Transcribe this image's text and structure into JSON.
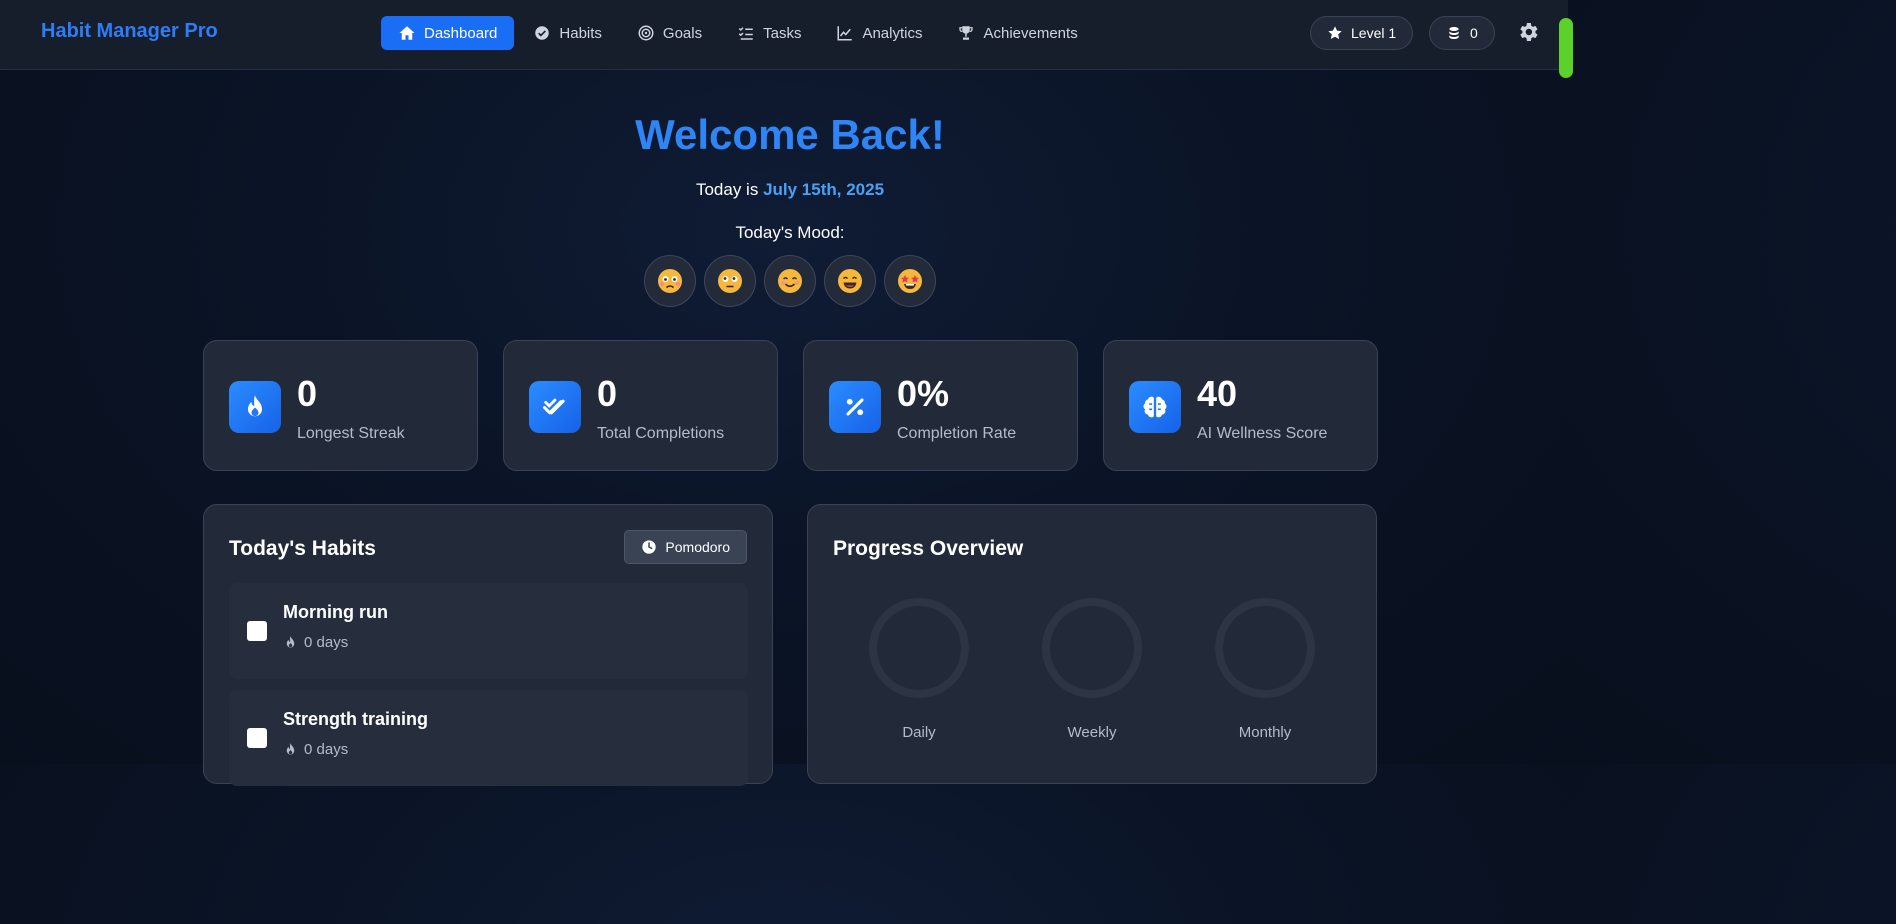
{
  "app": {
    "brand": "Habit Manager Pro"
  },
  "nav": {
    "items": [
      {
        "label": "Dashboard",
        "icon": "home-icon",
        "active": true
      },
      {
        "label": "Habits",
        "icon": "check-circle-icon",
        "active": false
      },
      {
        "label": "Goals",
        "icon": "target-icon",
        "active": false
      },
      {
        "label": "Tasks",
        "icon": "task-list-icon",
        "active": false
      },
      {
        "label": "Analytics",
        "icon": "line-chart-icon",
        "active": false
      },
      {
        "label": "Achievements",
        "icon": "trophy-icon",
        "active": false
      }
    ]
  },
  "header": {
    "level_label": "Level 1",
    "coins": "0"
  },
  "hero": {
    "welcome": "Welcome Back!",
    "today_prefix": "Today is ",
    "date": "July 15th, 2025",
    "mood_label": "Today's Mood:",
    "moods": [
      "very-sad-emoji",
      "neutral-emoji",
      "smiling-emoji",
      "grinning-emoji",
      "star-struck-emoji"
    ]
  },
  "stats": [
    {
      "value": "0",
      "label": "Longest Streak",
      "icon": "flame-icon"
    },
    {
      "value": "0",
      "label": "Total Completions",
      "icon": "double-check-icon"
    },
    {
      "value": "0%",
      "label": "Completion Rate",
      "icon": "percent-icon"
    },
    {
      "value": "40",
      "label": "AI Wellness Score",
      "icon": "brain-icon"
    }
  ],
  "habits_panel": {
    "title": "Today's Habits",
    "pomodoro_label": "Pomodoro",
    "habits": [
      {
        "name": "Morning run",
        "streak": "0 days"
      },
      {
        "name": "Strength training",
        "streak": "0 days"
      }
    ]
  },
  "progress_panel": {
    "title": "Progress Overview",
    "rings": [
      {
        "label": "Daily",
        "progress": 0
      },
      {
        "label": "Weekly",
        "progress": 0
      },
      {
        "label": "Monthly",
        "progress": 0
      }
    ]
  },
  "colors": {
    "accent": "#1a6ef5",
    "brand": "#2f7df6",
    "date": "#4aa0f5",
    "streak_badge": "#5bd12b"
  }
}
